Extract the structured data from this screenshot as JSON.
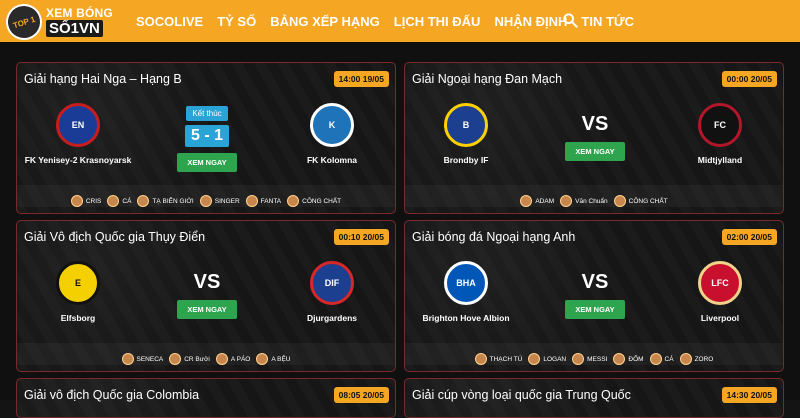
{
  "brand": {
    "top_text": "XEM BÓNG ĐÁ",
    "bottom_text": "SỐ1VN",
    "ball_text": "TOP 1"
  },
  "nav": [
    "SOCOLIVE",
    "TỶ SỐ",
    "BẢNG XẾP HẠNG",
    "LỊCH THI ĐẤU",
    "NHẬN ĐỊNH",
    "TIN TỨC"
  ],
  "matches": [
    {
      "league": "Giải hạng Hai Nga – Hạng B",
      "time": "14:00 19/05",
      "home": "FK Yenisey-2 Krasnoyarsk",
      "away": "FK Kolomna",
      "status": "Kết thúc",
      "score": "5 - 1",
      "watch": "XEM NGAY",
      "commentators": [
        "CRIS",
        "CÁ",
        "TẠ BIÊN GIỚI",
        "SINGER",
        "FANTA",
        "CÔNG CHẤT"
      ]
    },
    {
      "league": "Giải Ngoại hạng Đan Mạch",
      "time": "00:00 20/05",
      "home": "Brondby IF",
      "away": "Midtjylland",
      "vs": "VS",
      "watch": "XEM NGAY",
      "commentators": [
        "ADAM",
        "Văn Chuẩn",
        "CÔNG CHẤT"
      ]
    },
    {
      "league": "Giải Vô địch Quốc gia Thụy Điển",
      "time": "00:10 20/05",
      "home": "Elfsborg",
      "away": "Djurgardens",
      "vs": "VS",
      "watch": "XEM NGAY",
      "commentators": [
        "SENECA",
        "CR Bưởi",
        "A PÁO",
        "A BỆU"
      ]
    },
    {
      "league": "Giải bóng đá Ngoại hạng Anh",
      "time": "02:00 20/05",
      "home": "Brighton Hove Albion",
      "away": "Liverpool",
      "vs": "VS",
      "watch": "XEM NGAY",
      "commentators": [
        "THẠCH TÚ",
        "LOGAN",
        "MESSI",
        "ĐỐM",
        "CÁ",
        "ZORO"
      ]
    },
    {
      "league": "Giải vô địch Quốc gia Colombia",
      "time": "08:05 20/05"
    },
    {
      "league": "Giải cúp vòng loại quốc gia Trung Quốc",
      "time": "14:30 20/05"
    }
  ],
  "colors": {
    "accent": "#f5a623",
    "status_blue": "#2aa3d6",
    "watch_green": "#2ea44f",
    "card_border": "#7a2a2a"
  }
}
